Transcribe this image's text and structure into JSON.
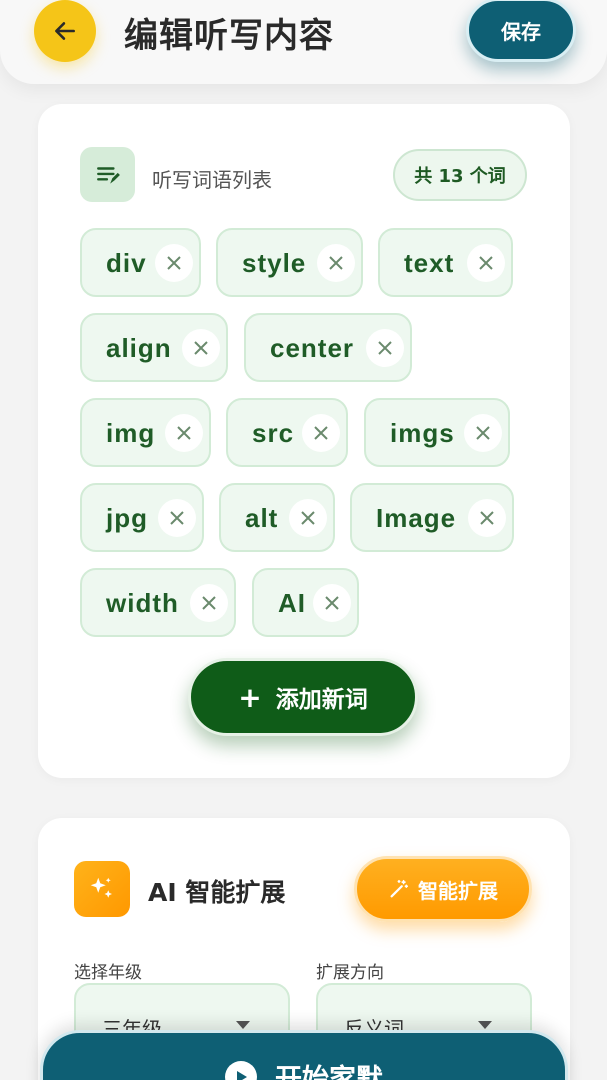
{
  "header": {
    "title": "编辑听写内容",
    "save_label": "保存"
  },
  "word_list": {
    "title": "听写词语列表",
    "count_label": "共 13 个词",
    "words": [
      "div",
      "style",
      "text",
      "align",
      "center",
      "img",
      "src",
      "imgs",
      "jpg",
      "alt",
      "Image",
      "width",
      "AI"
    ],
    "add_label": "添加新词"
  },
  "ai_expand": {
    "title": "AI 智能扩展",
    "button_label": "智能扩展",
    "grade_label": "选择年级",
    "grade_value": "三年级",
    "direction_label": "扩展方向",
    "direction_value": "反义词"
  },
  "footer": {
    "start_label": "开始家默"
  },
  "colors": {
    "accent_teal": "#0e5f74",
    "accent_green": "#0f5c18",
    "chip_bg": "#eef8f0",
    "back_yellow": "#f5c518",
    "ai_orange": "#ff9a00"
  }
}
